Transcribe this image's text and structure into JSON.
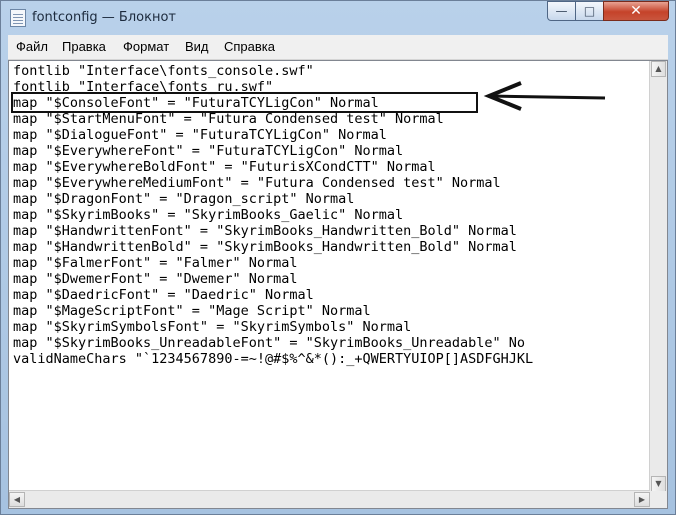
{
  "window": {
    "title": "fontconfig — Блокнот"
  },
  "caption_buttons": {
    "minimize": "—",
    "maximize": "□",
    "close": "✕"
  },
  "menu": [
    "Файл",
    "Правка",
    "Формат",
    "Вид",
    "Справка"
  ],
  "lines": [
    "fontlib \"Interface\\fonts_console.swf\"",
    "fontlib \"Interface\\fonts_ru.swf\"",
    "map \"$ConsoleFont\" = \"FuturaTCYLigCon\" Normal",
    "map \"$StartMenuFont\" = \"Futura Condensed test\" Normal",
    "map \"$DialogueFont\" = \"FuturaTCYLigCon\" Normal",
    "map \"$EverywhereFont\" = \"FuturaTCYLigCon\" Normal",
    "map \"$EverywhereBoldFont\" = \"FuturisXCondCTT\" Normal",
    "map \"$EverywhereMediumFont\" = \"Futura Condensed test\" Normal",
    "map \"$DragonFont\" = \"Dragon_script\" Normal",
    "map \"$SkyrimBooks\" = \"SkyrimBooks_Gaelic\" Normal",
    "map \"$HandwrittenFont\" = \"SkyrimBooks_Handwritten_Bold\" Normal",
    "map \"$HandwrittenBold\" = \"SkyrimBooks_Handwritten_Bold\" Normal",
    "map \"$FalmerFont\" = \"Falmer\" Normal",
    "map \"$DwemerFont\" = \"Dwemer\" Normal",
    "map \"$DaedricFont\" = \"Daedric\" Normal",
    "map \"$MageScriptFont\" = \"Mage Script\" Normal",
    "map \"$SkyrimSymbolsFont\" = \"SkyrimSymbols\" Normal",
    "map \"$SkyrimBooks_UnreadableFont\" = \"SkyrimBooks_Unreadable\" No",
    "validNameChars \"`1234567890-=~!@#$%^&*():_+QWERTYUIOP[]ASDFGHJKL"
  ],
  "annotation": {
    "highlighted_line": 3,
    "arrow_color": "#111111"
  }
}
